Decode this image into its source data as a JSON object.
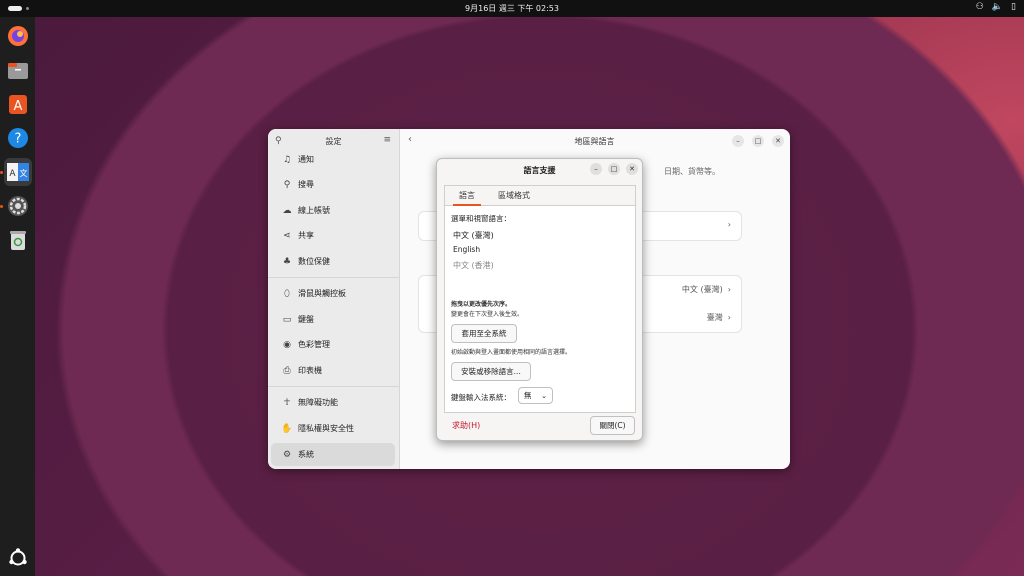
{
  "topbar": {
    "clock": "9月16日 週三 下午 02:53",
    "tray": [
      "network-icon",
      "volume-icon",
      "battery-icon"
    ]
  },
  "dock": {
    "apps": [
      "firefox",
      "files",
      "app-center",
      "help",
      "language-support",
      "settings",
      "trash",
      "show-apps"
    ]
  },
  "settings": {
    "sidebar_title": "設定",
    "main_title": "地區與語言",
    "sidebar_items": [
      {
        "label": "通知",
        "icon": "bell-icon"
      },
      {
        "label": "搜尋",
        "icon": "search-icon"
      },
      {
        "label": "線上帳號",
        "icon": "cloud-icon"
      },
      {
        "label": "共享",
        "icon": "share-icon"
      },
      {
        "label": "數位保健",
        "icon": "wellbeing-icon"
      },
      {
        "label": "滑鼠與觸控板",
        "icon": "mouse-icon"
      },
      {
        "label": "鍵盤",
        "icon": "keyboard-icon"
      },
      {
        "label": "色彩管理",
        "icon": "color-icon"
      },
      {
        "label": "印表機",
        "icon": "printer-icon"
      },
      {
        "label": "無障礙功能",
        "icon": "accessibility-icon"
      },
      {
        "label": "隱私權與安全性",
        "icon": "privacy-icon"
      },
      {
        "label": "系統",
        "icon": "gear-icon"
      }
    ],
    "desc_fragment": "日期、貨幣等。",
    "row_language_value": "中文 (臺灣)",
    "row_region_value": "臺灣"
  },
  "dialog": {
    "title": "語言支援",
    "tabs": [
      "語言",
      "區域格式"
    ],
    "menu_lang_label": "選單和視窗語言：",
    "languages": [
      "中文 (臺灣)",
      "English",
      "中文 (香港)"
    ],
    "drag_hint": "拖曳以更改優先次序。",
    "drag_hint_sub": "變更會在下次登入後生效。",
    "apply_button": "套用至全系統",
    "apply_note": "初始啟動與登入畫面都使用相同的語言選擇。",
    "install_button": "安裝或移除語言...",
    "input_method_label": "鍵盤輸入法系統：",
    "input_method_value": "無",
    "help_button": "求助(H)",
    "close_button": "關閉(C)"
  }
}
